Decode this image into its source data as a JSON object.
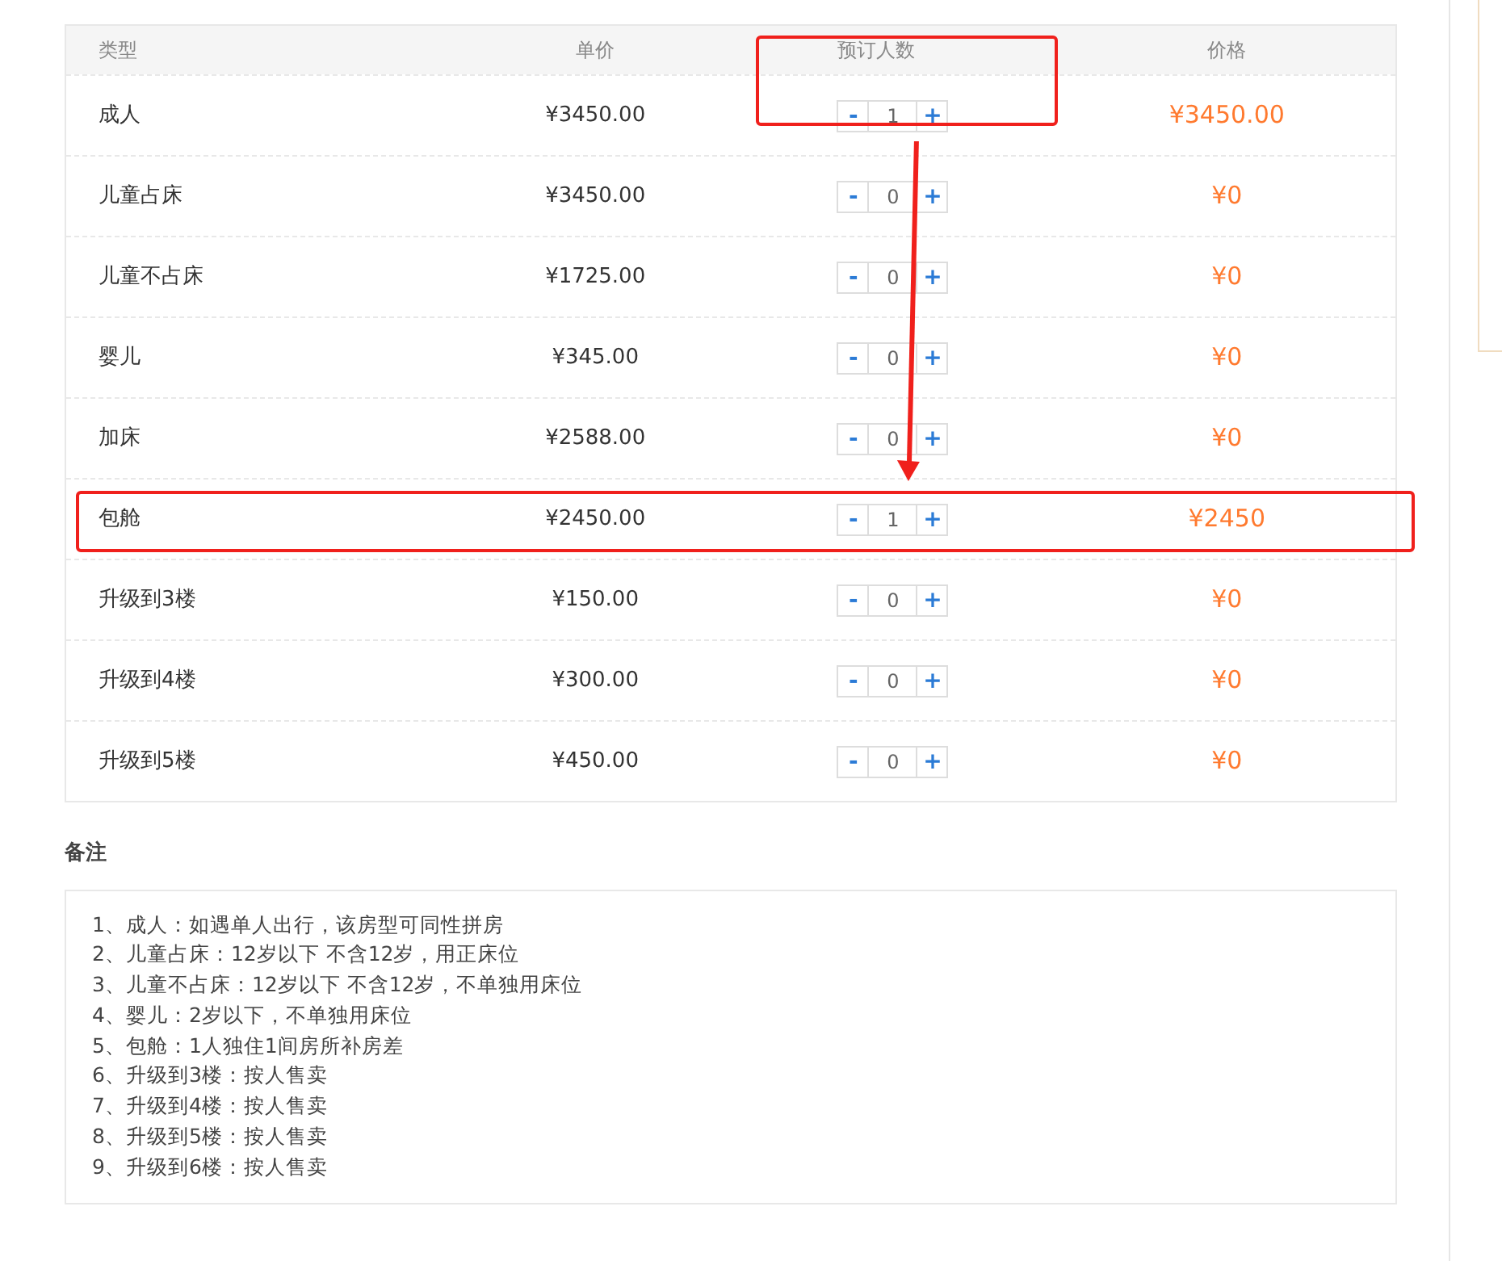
{
  "table": {
    "columns": [
      {
        "label": "类型",
        "highlighted": false
      },
      {
        "label": "单价",
        "highlighted": false
      },
      {
        "label": "预订人数",
        "highlighted": true
      },
      {
        "label": "价格",
        "highlighted": false
      }
    ],
    "rows": [
      {
        "type": "成人",
        "unit_price": "¥3450.00",
        "minus": "-",
        "quantity": "1",
        "plus": "+",
        "price": "¥3450.00",
        "highlighted": false
      },
      {
        "type": "儿童占床",
        "unit_price": "¥3450.00",
        "minus": "-",
        "quantity": "0",
        "plus": "+",
        "price": "¥0",
        "highlighted": false
      },
      {
        "type": "儿童不占床",
        "unit_price": "¥1725.00",
        "minus": "-",
        "quantity": "0",
        "plus": "+",
        "price": "¥0",
        "highlighted": false
      },
      {
        "type": "婴儿",
        "unit_price": "¥345.00",
        "minus": "-",
        "quantity": "0",
        "plus": "+",
        "price": "¥0",
        "highlighted": false
      },
      {
        "type": "加床",
        "unit_price": "¥2588.00",
        "minus": "-",
        "quantity": "0",
        "plus": "+",
        "price": "¥0",
        "highlighted": false
      },
      {
        "type": "包舱",
        "unit_price": "¥2450.00",
        "minus": "-",
        "quantity": "1",
        "plus": "+",
        "price": "¥2450",
        "highlighted": true
      },
      {
        "type": "升级到3楼",
        "unit_price": "¥150.00",
        "minus": "-",
        "quantity": "0",
        "plus": "+",
        "price": "¥0",
        "highlighted": false
      },
      {
        "type": "升级到4楼",
        "unit_price": "¥300.00",
        "minus": "-",
        "quantity": "0",
        "plus": "+",
        "price": "¥0",
        "highlighted": false
      },
      {
        "type": "升级到5楼",
        "unit_price": "¥450.00",
        "minus": "-",
        "quantity": "0",
        "plus": "+",
        "price": "¥0",
        "highlighted": false
      }
    ]
  },
  "notes": {
    "title": "备注",
    "lines": [
      "1、成人：如遇单人出行，该房型可同性拼房",
      "2、儿童占床：12岁以下 不含12岁，用正床位",
      "3、儿童不占床：12岁以下 不含12岁，不单独用床位",
      "4、婴儿：2岁以下，不单独用床位",
      "5、包舱：1人独住1间房所补房差",
      "6、升级到3楼：按人售卖",
      "7、升级到4楼：按人售卖",
      "8、升级到5楼：按人售卖",
      "9、升级到6楼：按人售卖"
    ]
  }
}
